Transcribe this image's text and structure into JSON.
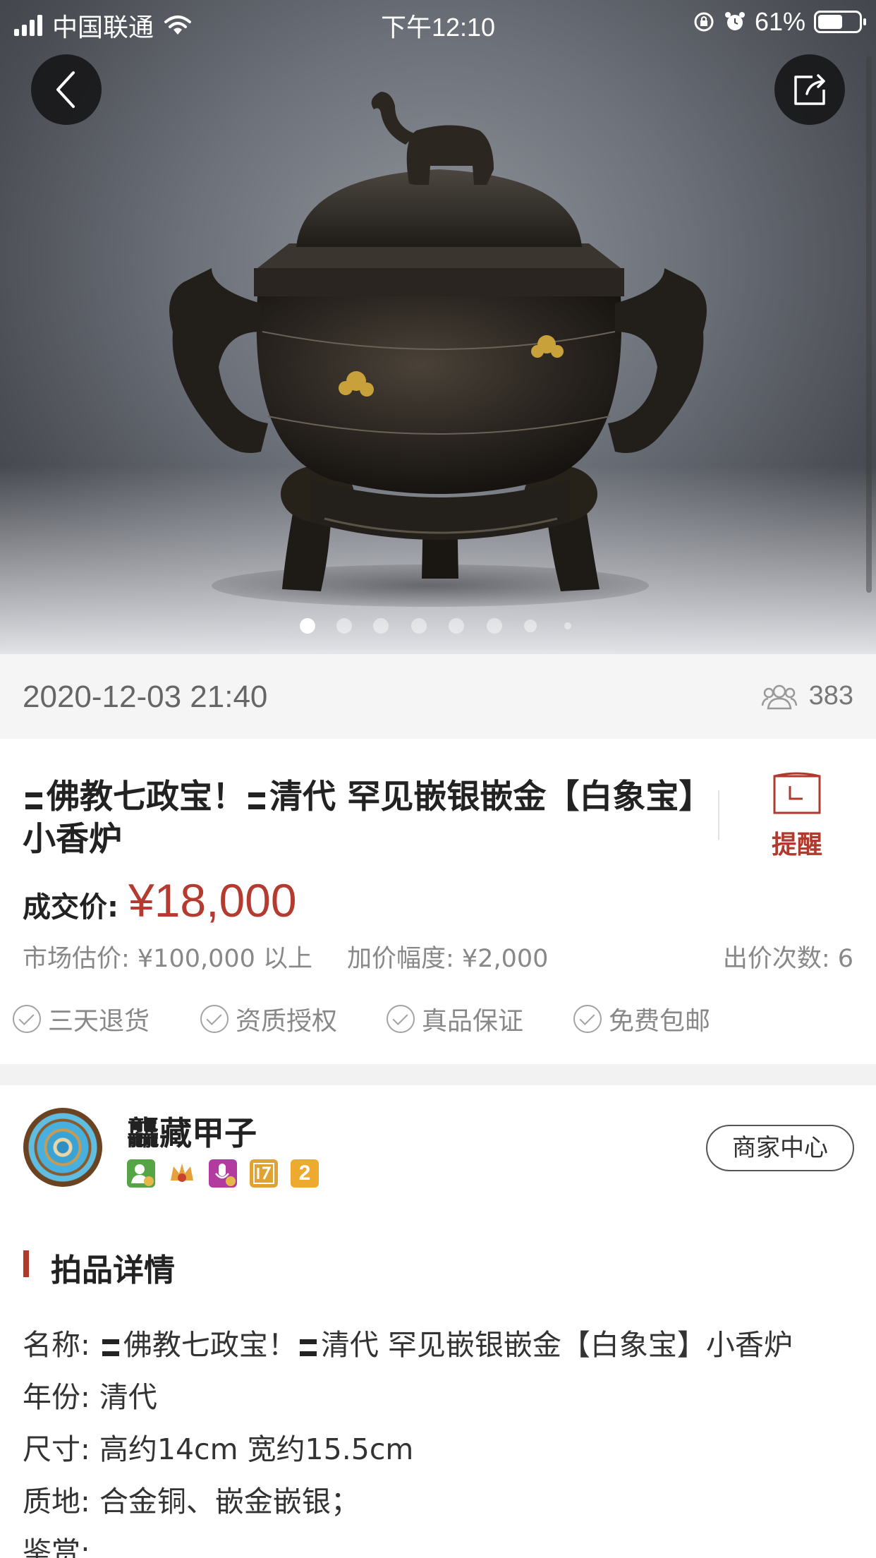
{
  "status_bar": {
    "carrier": "中国联通",
    "time": "下午12:10",
    "battery": "61%",
    "battery_level": 0.61
  },
  "gallery": {
    "image_count": 8,
    "active_index": 0
  },
  "meta": {
    "date": "2020-12-03 21:40",
    "views": "383"
  },
  "item": {
    "title_part1": "佛教七政宝！",
    "title_part2": "清代 罕见嵌银嵌金【白象宝】小香炉",
    "remind_label": "提醒",
    "price_label": "成交价:",
    "price": "¥18,000",
    "estimate": "市场估价: ¥100,000 以上",
    "increment": "加价幅度: ¥2,000",
    "bid_count": "出价次数: 6",
    "badges": [
      "三天退货",
      "资质授权",
      "真品保证",
      "免费包邮"
    ]
  },
  "seller": {
    "name": "龘藏甲子",
    "merchant_button": "商家中心",
    "level_badge": "2"
  },
  "details": {
    "section_title": "拍品详情",
    "name_key": "名称:",
    "name_part1": "佛教七政宝！",
    "name_part2": "清代 罕见嵌银嵌金【白象宝】小香炉",
    "year_key": "年份:",
    "year": "清代",
    "size_key": "尺寸:",
    "size": "高约14cm 宽约15.5cm",
    "material_key": "质地:",
    "material": "合金铜、嵌金嵌银；",
    "appreciation_key": "鉴赏:"
  },
  "colors": {
    "accent": "#b53a2f",
    "muted_text": "#888888"
  },
  "icons": [
    "signal-icon",
    "wifi-icon",
    "orientation-lock-icon",
    "alarm-icon",
    "battery-icon",
    "back-arrow-icon",
    "share-icon",
    "viewers-icon",
    "calendar-remind-icon",
    "check-circle-icon"
  ]
}
